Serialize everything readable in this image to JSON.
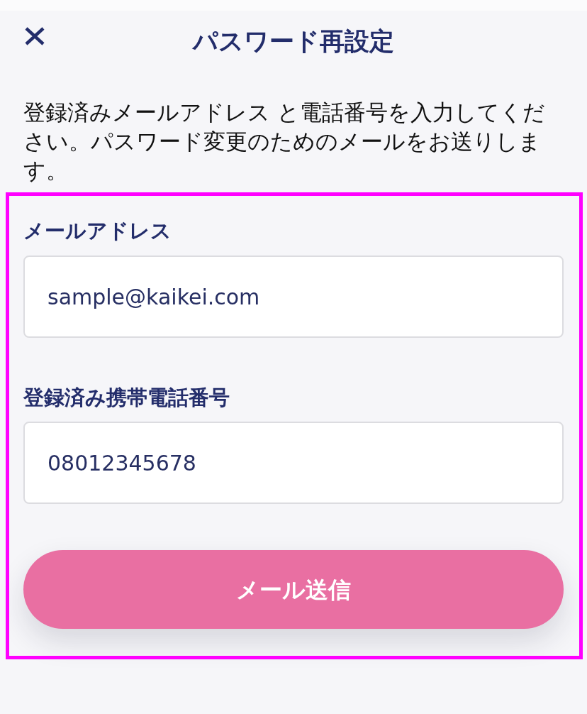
{
  "header": {
    "title": "パスワード再設定"
  },
  "description": "登録済みメールアドレス と電話番号を入力してください。パスワード変更のためのメールをお送りします。",
  "form": {
    "highlighted": true,
    "fields": [
      {
        "label": "メールアドレス",
        "value": "sample@kaikei.com"
      },
      {
        "label": "登録済み携帯電話番号",
        "value": "08012345678"
      }
    ],
    "submit_button": "メール送信"
  }
}
